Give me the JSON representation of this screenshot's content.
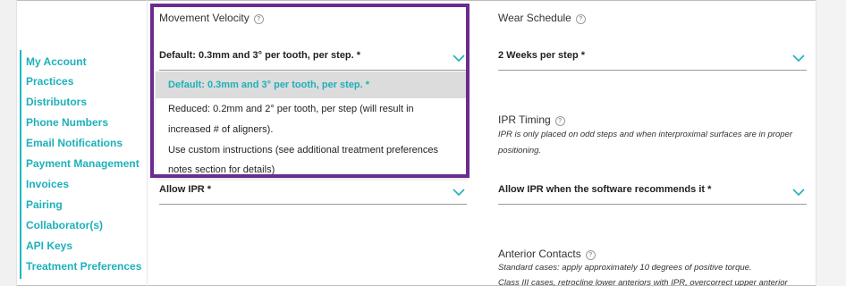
{
  "sidebar": {
    "items": [
      {
        "label": "My Account"
      },
      {
        "label": "Practices"
      },
      {
        "label": "Distributors"
      },
      {
        "label": "Phone Numbers"
      },
      {
        "label": "Email Notifications"
      },
      {
        "label": "Payment Management"
      },
      {
        "label": "Invoices"
      },
      {
        "label": "Pairing"
      },
      {
        "label": "Collaborator(s)"
      },
      {
        "label": "API Keys"
      },
      {
        "label": "Treatment Preferences"
      }
    ]
  },
  "movement_velocity": {
    "label": "Movement Velocity",
    "value": "Default: 0.3mm and 3° per tooth, per step. *",
    "options": [
      "Default: 0.3mm and 3° per tooth, per step. *",
      "Reduced: 0.2mm and 2° per tooth, per step (will result in",
      "increased # of aligners).",
      "Use custom instructions (see additional treatment preferences",
      "notes section for details)"
    ]
  },
  "allow_ipr": {
    "value": "Allow IPR *"
  },
  "wear_schedule": {
    "label": "Wear Schedule",
    "value": "2 Weeks per step *"
  },
  "ipr_timing": {
    "label": "IPR Timing",
    "hint_line1": "IPR is only placed on odd steps and when interproximal surfaces are in proper",
    "hint_line2": "positioning.",
    "value": "Allow IPR when the software recommends it *"
  },
  "anterior_contacts": {
    "label": "Anterior Contacts",
    "hint_line1": "Standard cases: apply approximately 10 degrees of positive torque.",
    "hint_line2": "Class III cases, retrocline lower anteriors with IPR, overcorrect upper anterior"
  },
  "help_glyph": "?",
  "colors": {
    "accent": "#1db0ba",
    "highlight_border": "#6b2c8f",
    "selected_bg": "#dcdcdc"
  }
}
